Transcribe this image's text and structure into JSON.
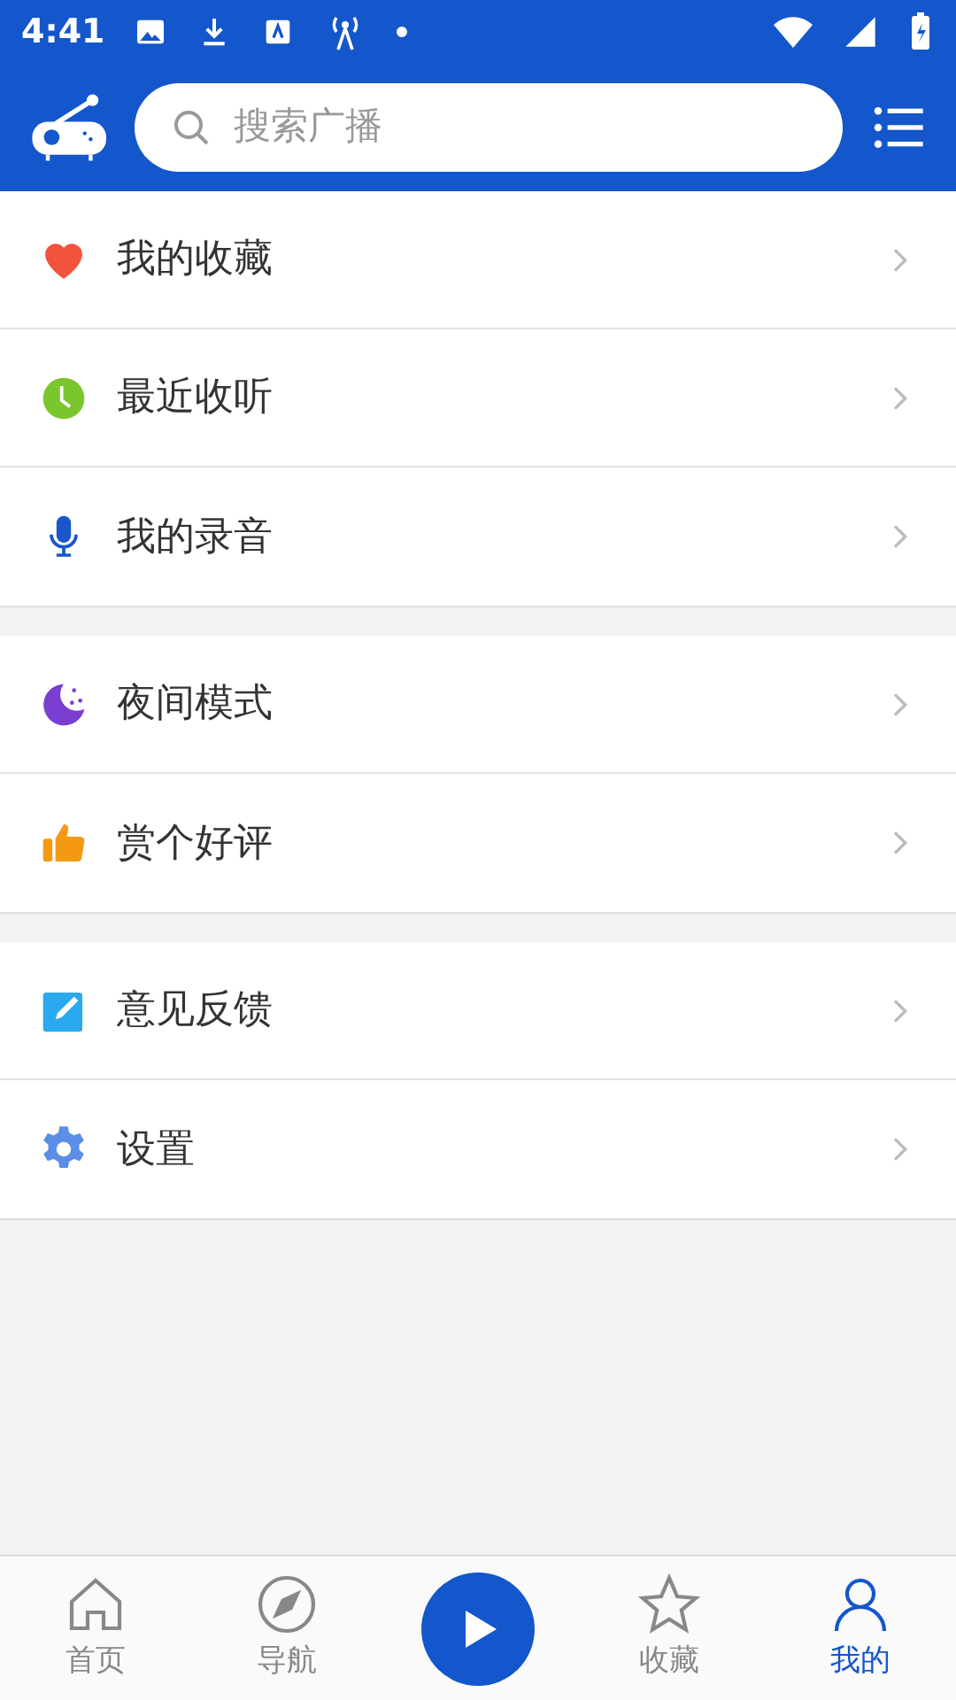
{
  "status_bar": {
    "time": "4:41"
  },
  "search": {
    "placeholder": "搜索广播"
  },
  "menu_groups": [
    [
      {
        "kind": "heart",
        "label": "我的收藏"
      },
      {
        "kind": "clock",
        "label": "最近收听"
      },
      {
        "kind": "mic",
        "label": "我的录音"
      }
    ],
    [
      {
        "kind": "moon",
        "label": "夜间模式"
      },
      {
        "kind": "thumb",
        "label": "赏个好评"
      }
    ],
    [
      {
        "kind": "edit",
        "label": "意见反馈"
      },
      {
        "kind": "gear",
        "label": "设置"
      }
    ]
  ],
  "bottom_nav": [
    {
      "kind": "home",
      "label": "首页",
      "selected": false
    },
    {
      "kind": "compass",
      "label": "导航",
      "selected": false
    },
    {
      "kind": "play"
    },
    {
      "kind": "star",
      "label": "收藏",
      "selected": false
    },
    {
      "kind": "person",
      "label": "我的",
      "selected": true
    }
  ]
}
